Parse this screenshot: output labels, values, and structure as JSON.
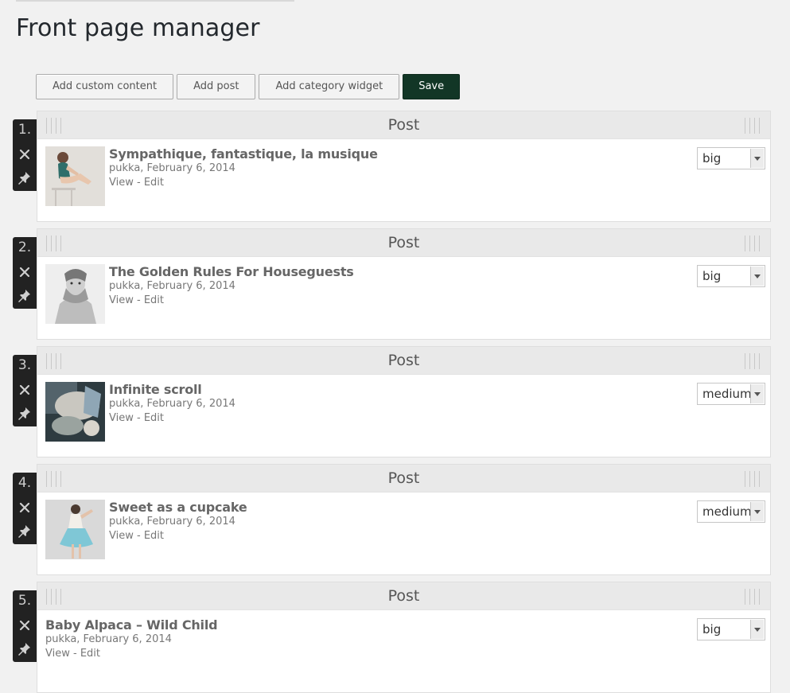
{
  "page": {
    "title": "Front page manager"
  },
  "toolbar": {
    "add_custom": "Add custom content",
    "add_post": "Add post",
    "add_widget": "Add category widget",
    "save": "Save"
  },
  "colors": {
    "primary_button": "#123626",
    "side_bar": "#222222"
  },
  "items": [
    {
      "number": "1.",
      "type": "Post",
      "title": "Sympathique, fantastique, la musique",
      "meta": "pukka, February 6, 2014",
      "view": "View",
      "sep": " - ",
      "edit": "Edit",
      "size": "big",
      "has_thumb": true,
      "thumb_icon": "photo-woman-sitting"
    },
    {
      "number": "2.",
      "type": "Post",
      "title": "The Golden Rules For Houseguests",
      "meta": "pukka, February 6, 2014",
      "view": "View",
      "sep": " - ",
      "edit": "Edit",
      "size": "big",
      "has_thumb": true,
      "thumb_icon": "photo-woman-bw"
    },
    {
      "number": "3.",
      "type": "Post",
      "title": "Infinite scroll",
      "meta": "pukka, February 6, 2014",
      "view": "View",
      "sep": " - ",
      "edit": "Edit",
      "size": "medium",
      "has_thumb": true,
      "thumb_icon": "photo-abstract"
    },
    {
      "number": "4.",
      "type": "Post",
      "title": "Sweet as a cupcake",
      "meta": "pukka, February 6, 2014",
      "view": "View",
      "sep": " - ",
      "edit": "Edit",
      "size": "medium",
      "has_thumb": true,
      "thumb_icon": "photo-woman-dress"
    },
    {
      "number": "5.",
      "type": "Post",
      "title": "Baby Alpaca – Wild Child",
      "meta": "pukka, February 6, 2014",
      "view": "View",
      "sep": " - ",
      "edit": "Edit",
      "size": "big",
      "has_thumb": false
    }
  ]
}
